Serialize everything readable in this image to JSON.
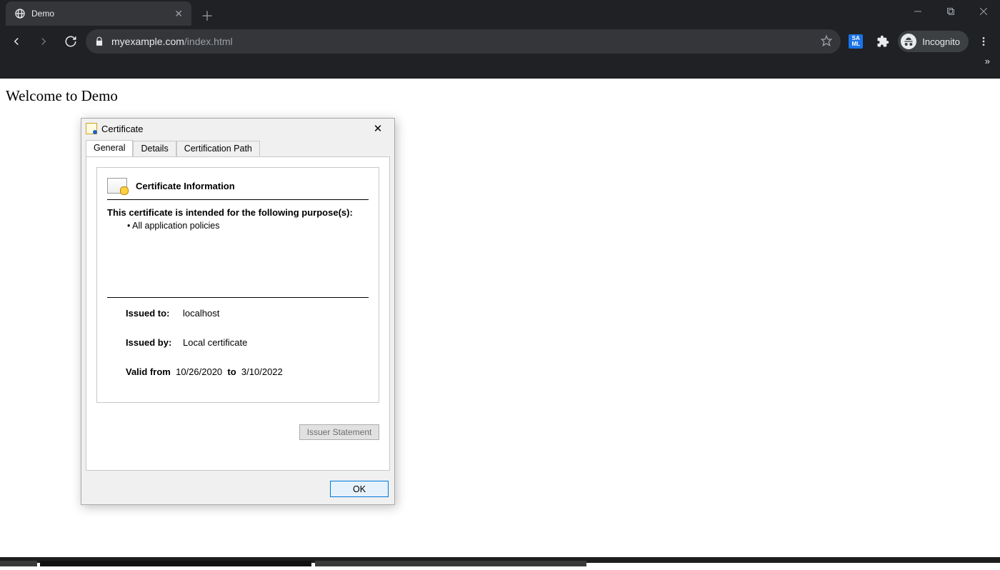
{
  "browser": {
    "tab_title": "Demo",
    "url_host": "myexample.com",
    "url_path": "/index.html",
    "incognito_label": "Incognito",
    "saml_badge": "SA\nML"
  },
  "page": {
    "heading": "Welcome to Demo"
  },
  "dialog": {
    "title": "Certificate",
    "tabs": {
      "general": "General",
      "details": "Details",
      "certpath": "Certification Path"
    },
    "info_heading": "Certificate Information",
    "purpose_line": "This certificate is intended for the following purpose(s):",
    "purpose_item": "• All application policies",
    "issued_to_label": "Issued to:",
    "issued_to_value": "localhost",
    "issued_by_label": "Issued by:",
    "issued_by_value": "Local certificate",
    "valid_from_label": "Valid from",
    "valid_from_value": "10/26/2020",
    "valid_to_label": "to",
    "valid_to_value": "3/10/2022",
    "issuer_statement_btn": "Issuer Statement",
    "ok_btn": "OK"
  }
}
